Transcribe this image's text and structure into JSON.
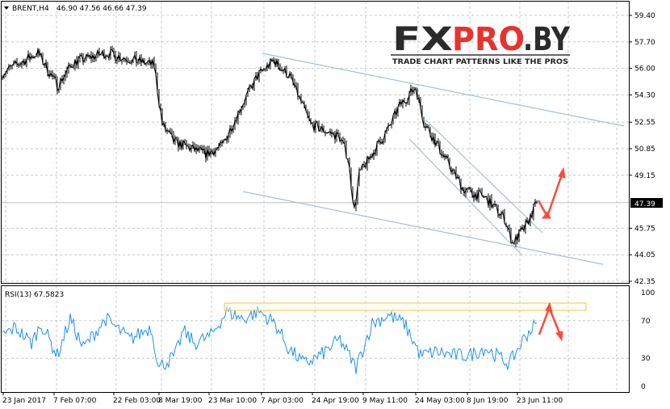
{
  "header": {
    "symbol_label": "BRENT,H4",
    "ohlc": "46.90 47.56 46.66 47.39"
  },
  "logo": {
    "brand": "FXPRO.BY",
    "tagline": "TRADE CHART PATTERNS LIKE THE PROS"
  },
  "rsi": {
    "label": "RSI(13) 67.5823"
  },
  "colors": {
    "price": "#000000",
    "rsi": "#1e90ff",
    "trendline": "#a9c0cf",
    "arrow": "#ff4a3a",
    "zone": "#f5c542",
    "last_price_bg": "#000000"
  },
  "chart_data": [
    {
      "type": "line",
      "title": "BRENT,H4",
      "price_axis_ticks": [
        "59.40",
        "57.70",
        "56.00",
        "54.30",
        "52.55",
        "50.85",
        "49.15",
        "45.75",
        "44.05",
        "42.35"
      ],
      "last_price": "47.39",
      "ylim": [
        42.35,
        59.4
      ],
      "x_tick_labels": [
        "23 Jan 2017",
        "7 Feb 07:00",
        "22 Feb 03:00",
        "8 Mar 19:00",
        "23 Mar 10:00",
        "7 Apr 03:00",
        "24 Apr 19:00",
        "9 May 11:00",
        "24 May 03:00",
        "8 Jun 19:00",
        "23 Jun 11:00"
      ],
      "close_waypoints": [
        [
          0,
          55.7
        ],
        [
          22,
          57.0
        ],
        [
          34,
          54.9
        ],
        [
          44,
          56.4
        ],
        [
          64,
          57.0
        ],
        [
          94,
          56.2
        ],
        [
          99,
          52.4
        ],
        [
          106,
          51.3
        ],
        [
          126,
          50.5
        ],
        [
          136,
          51.0
        ],
        [
          148,
          53.6
        ],
        [
          158,
          55.5
        ],
        [
          168,
          56.5
        ],
        [
          178,
          55.5
        ],
        [
          186,
          53.6
        ],
        [
          191,
          52.4
        ],
        [
          209,
          51.6
        ],
        [
          214,
          50.3
        ],
        [
          218,
          46.9
        ],
        [
          221,
          49.2
        ],
        [
          229,
          50.5
        ],
        [
          239,
          52.1
        ],
        [
          246,
          53.6
        ],
        [
          256,
          54.8
        ],
        [
          261,
          52.6
        ],
        [
          271,
          50.8
        ],
        [
          286,
          48.2
        ],
        [
          299,
          47.7
        ],
        [
          311,
          46.4
        ],
        [
          316,
          44.8
        ],
        [
          324,
          45.8
        ],
        [
          331,
          47.39
        ]
      ]
    },
    {
      "type": "line",
      "title": "RSI(13) 67.5823",
      "ylim": [
        0,
        100
      ],
      "y_tick_labels": [
        "100",
        "70",
        "30",
        "0"
      ],
      "levels": [
        70,
        30
      ],
      "value_waypoints": [
        [
          0,
          54
        ],
        [
          8,
          63
        ],
        [
          18,
          46
        ],
        [
          24,
          67
        ],
        [
          34,
          33
        ],
        [
          42,
          72
        ],
        [
          50,
          41
        ],
        [
          64,
          72
        ],
        [
          79,
          50
        ],
        [
          92,
          63
        ],
        [
          97,
          20
        ],
        [
          107,
          33
        ],
        [
          112,
          59
        ],
        [
          119,
          46
        ],
        [
          129,
          54
        ],
        [
          139,
          80
        ],
        [
          149,
          72
        ],
        [
          159,
          80
        ],
        [
          169,
          67
        ],
        [
          177,
          41
        ],
        [
          187,
          24
        ],
        [
          197,
          33
        ],
        [
          209,
          50
        ],
        [
          219,
          20
        ],
        [
          229,
          67
        ],
        [
          239,
          76
        ],
        [
          249,
          67
        ],
        [
          259,
          33
        ],
        [
          269,
          37
        ],
        [
          279,
          33
        ],
        [
          289,
          33
        ],
        [
          299,
          41
        ],
        [
          314,
          24
        ],
        [
          324,
          54
        ],
        [
          331,
          67.6
        ]
      ]
    }
  ]
}
